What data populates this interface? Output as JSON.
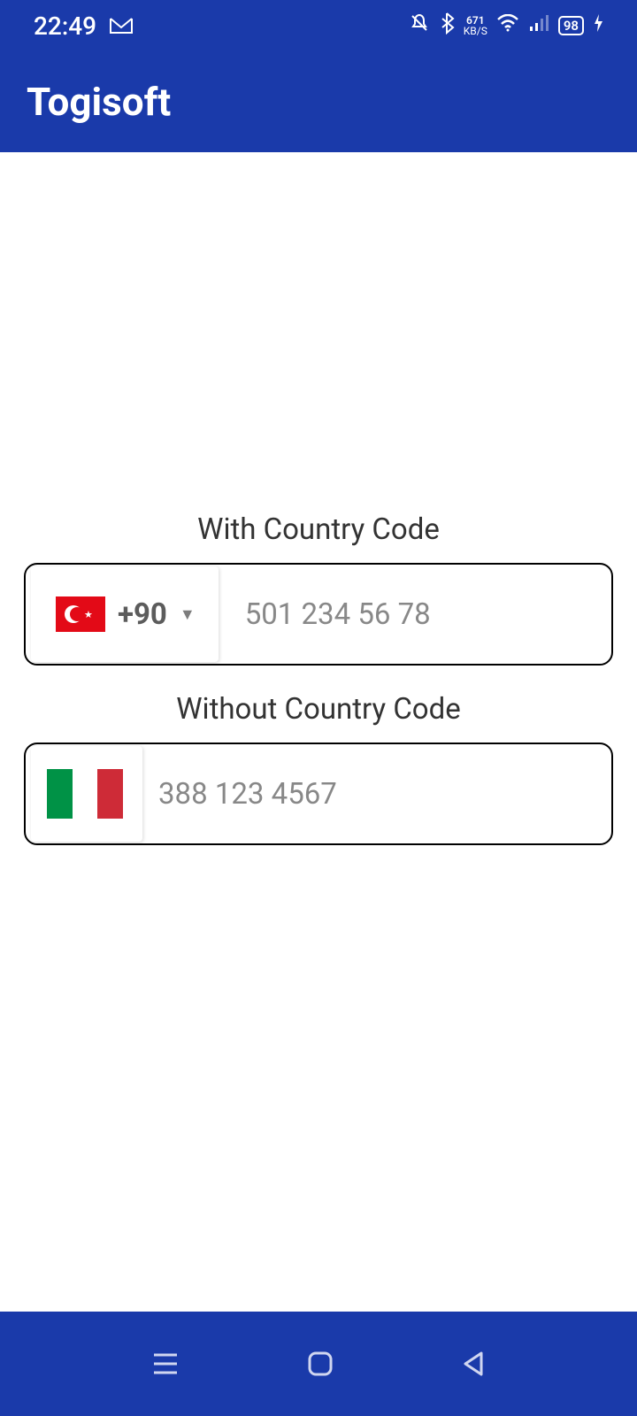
{
  "status_bar": {
    "time": "22:49",
    "net_speed_top": "671",
    "net_speed_unit": "KB/S",
    "battery": "98"
  },
  "app_bar": {
    "title": "Togisoft"
  },
  "section1": {
    "label": "With Country Code",
    "dial_code": "+90",
    "placeholder": "501 234 56 78"
  },
  "section2": {
    "label": "Without Country Code",
    "placeholder": "388 123 4567"
  }
}
